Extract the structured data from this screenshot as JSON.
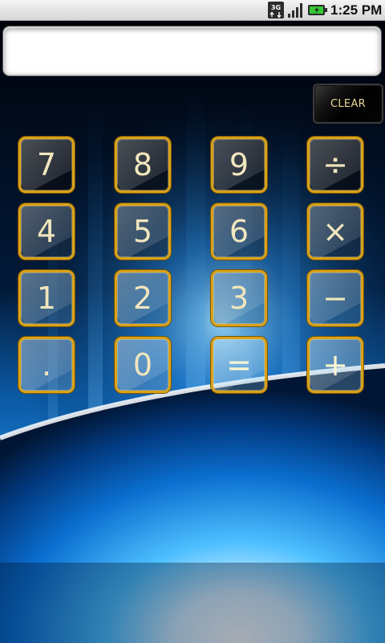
{
  "status_bar": {
    "network_label": "3G",
    "network_icon": "network-3g-icon",
    "signal_icon": "signal-strength-icon",
    "battery_icon": "battery-charging-icon",
    "time": "1:25 PM"
  },
  "display": {
    "value": ""
  },
  "clear_button": {
    "label": "CLEAR"
  },
  "keypad": {
    "rows": [
      [
        "7",
        "8",
        "9",
        "÷"
      ],
      [
        "4",
        "5",
        "6",
        "×"
      ],
      [
        "1",
        "2",
        "3",
        "−"
      ],
      [
        ".",
        "0",
        "=",
        "+"
      ]
    ]
  },
  "colors": {
    "key_border": "#d9a21a",
    "key_text": "#f1e6bd",
    "clear_text": "#e8d79a",
    "glow": "#2ea0ff"
  }
}
